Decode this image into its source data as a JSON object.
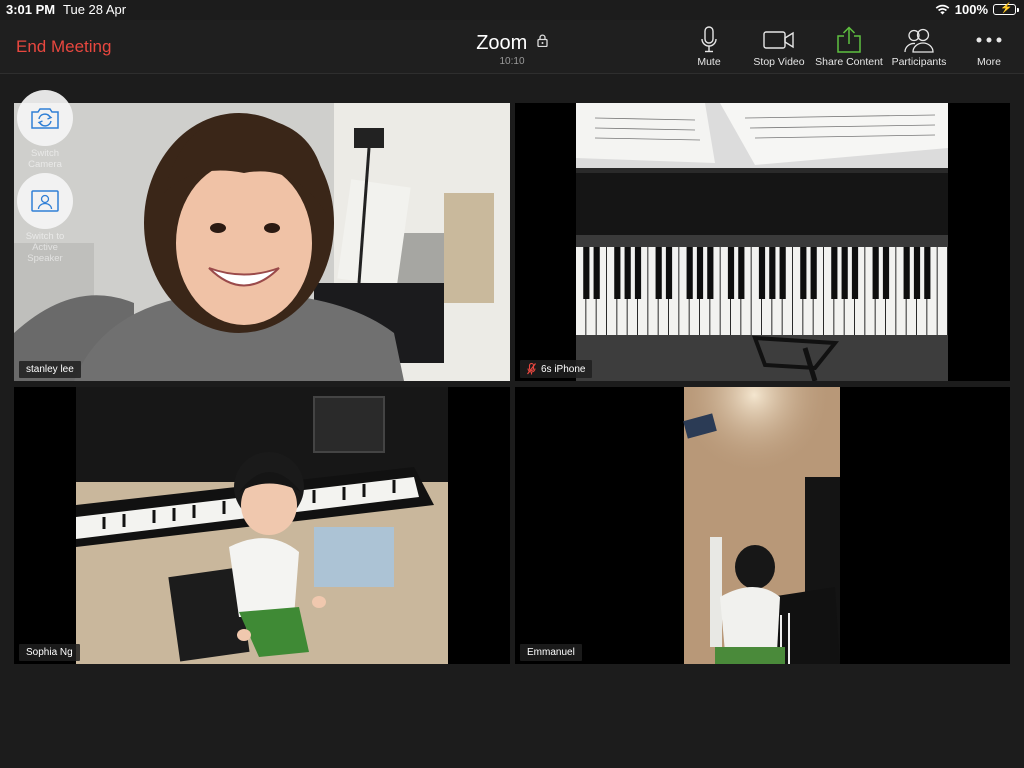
{
  "status_bar": {
    "time": "3:01 PM",
    "date": "Tue 28 Apr",
    "battery": "100%",
    "battery_level": 1.0
  },
  "header": {
    "end_meeting": "End Meeting",
    "title": "Zoom",
    "timer": "10:10",
    "tools": [
      {
        "label": "Mute",
        "icon": "microphone-icon"
      },
      {
        "label": "Stop Video",
        "icon": "video-camera-icon"
      },
      {
        "label": "Share Content",
        "icon": "share-upload-icon"
      },
      {
        "label": "Participants",
        "icon": "participants-icon"
      },
      {
        "label": "More",
        "icon": "more-dots-icon"
      }
    ]
  },
  "floating": {
    "switch_camera": "Switch Camera",
    "switch_speaker": "Switch to Active Speaker"
  },
  "tiles": [
    {
      "name": "stanley lee",
      "muted": false,
      "active": true
    },
    {
      "name": "6s iPhone",
      "muted": true,
      "active": false
    },
    {
      "name": "Sophia Ng",
      "muted": false,
      "active": false
    },
    {
      "name": "Emmanuel",
      "muted": false,
      "active": false
    }
  ],
  "colors": {
    "end_meeting": "#e8473f",
    "share_accent": "#5fc040",
    "active_border": "#6fc240",
    "battery": "#4cd964",
    "muted": "#e8473f"
  }
}
